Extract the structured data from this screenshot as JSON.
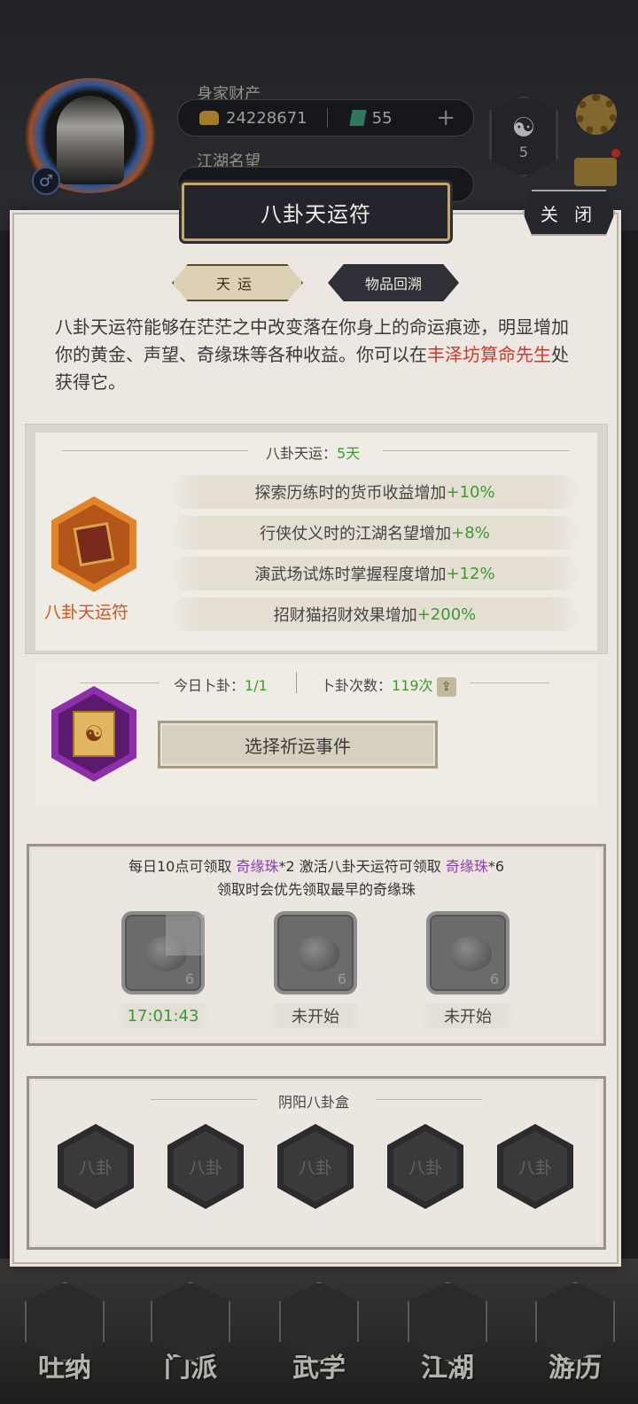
{
  "hud": {
    "wealth_label": "身家财产",
    "gold_amount": "24228671",
    "jade_amount": "55",
    "plus_glyph": "+",
    "fame_label": "江湖名望",
    "taiji_level": "5",
    "gender_glyph": "♂"
  },
  "modal": {
    "title": "八卦天运符",
    "close_label": "关 闭",
    "tabs": [
      {
        "label": "天运",
        "active": true
      },
      {
        "label": "物品回溯",
        "active": false
      }
    ],
    "description_part1": "八卦天运符能够在茫茫之中改变落在你身上的命运痕迹，明显增加你的黄金、声望、奇缘珠等各种收益。你可以在",
    "description_highlight": "丰泽坊算命先生",
    "description_part2": "处获得它。"
  },
  "status": {
    "label": "八卦天运：",
    "days": "5天",
    "item_name": "八卦天运符",
    "effects": [
      {
        "text": "探索历练时的货币收益增加 ",
        "bonus": "+10%"
      },
      {
        "text": "行侠仗义时的江湖名望增加 ",
        "bonus": "+8%"
      },
      {
        "text": "演武场试炼时掌握程度增加 ",
        "bonus": "+12%"
      },
      {
        "text": "招财猫招财效果增加 ",
        "bonus": "+200%"
      }
    ]
  },
  "divination": {
    "today_label": "今日卜卦：",
    "today_value": "1/1",
    "count_label": "卜卦次数：",
    "count_value": "119次",
    "choose_button": "选择祈运事件",
    "share_glyph": "⇪"
  },
  "orbs": {
    "line1_a": "每日10点可领取 ",
    "line1_orb1": "奇缘珠",
    "line1_b": "*2 激活八卦天运符可领取 ",
    "line1_orb2": "奇缘珠",
    "line1_c": "*6",
    "line2": "领取时会优先领取最早的奇缘珠",
    "slots": [
      {
        "count": "6",
        "status": "17:01:43"
      },
      {
        "count": "6",
        "status": "未开始"
      },
      {
        "count": "6",
        "status": "未开始"
      }
    ]
  },
  "bagua_box": {
    "title": "阴阳八卦盒",
    "slots": [
      "八卦",
      "八卦",
      "八卦",
      "八卦",
      "八卦"
    ]
  },
  "bottom_nav": [
    "吐纳",
    "门派",
    "武学",
    "江湖",
    "游历"
  ],
  "colors": {
    "highlight_red": "#c93a2e",
    "bonus_green": "#3d9a2e",
    "orb_purple": "#8b3fb0",
    "item_orange": "#d0561c"
  }
}
